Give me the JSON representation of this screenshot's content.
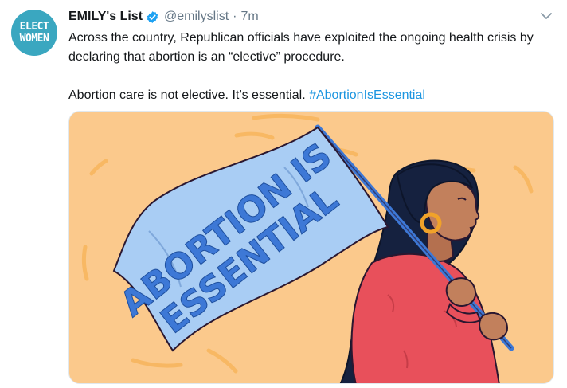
{
  "account": {
    "avatar_line1": "ELECT",
    "avatar_line2": "WOMEN",
    "name": "EMILY's List",
    "handle": "@emilyslist",
    "separator": "·",
    "time": "7m"
  },
  "tweet": {
    "text_para1": "Across the country, Republican officials have exploited the ongoing health crisis by declaring that abortion is an “elective” procedure.",
    "text_para2": "Abortion care is not elective. It’s essential. ",
    "hashtag": "#AbortionIsEssential"
  },
  "media": {
    "flag_line1": "ABORTION IS",
    "flag_line2": "ESSENTIAL"
  },
  "colors": {
    "avatar_bg": "#3aa7c0",
    "hashtag": "#1b95e0",
    "verified": "#1da1f2",
    "image_bg": "#fbc98c",
    "flag": "#a9cdf4",
    "flag_text": "#3d78d6",
    "sweater": "#e8505b"
  },
  "icons": {
    "verified": "verified-badge-icon",
    "caret": "chevron-down-icon"
  }
}
